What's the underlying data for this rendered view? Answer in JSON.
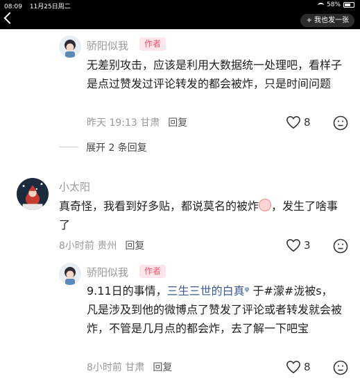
{
  "status_bar": {
    "time": "08:09",
    "date": "11月25日周二",
    "battery": "58%"
  },
  "header": {
    "new_button": "+ 我也发一张"
  },
  "comments": [
    {
      "author": "骄阳似我",
      "badge": "作者",
      "text": "无差别攻击，应该是利用大数据统一处理吧，看样子是点过赞发过评论转发的都会被炸，只是时间问题",
      "time_location": "昨天 19:13 甘肃",
      "reply_label": "回复",
      "likes": "8"
    },
    {
      "expand_label": "展开 2 条回复"
    },
    {
      "author": "小太阳",
      "text_before": "真奇怪，我看到好多贴，都说莫名的被炸",
      "text_after": "，发生了啥事了",
      "time_location": "8小时前 贵州",
      "reply_label": "回复",
      "likes": "3"
    },
    {
      "author": "骄阳似我",
      "badge": "作者",
      "text_prefix": "9.11日的事情，",
      "link_text": "三生三世的白真",
      "text_suffix": "于#濛#泷被s，凡是涉及到他的微博点了赞发了评论或者转发就会被炸，不管是几月点的都会炸，去了解一下吧宝",
      "time_location": "8小时前 甘肃",
      "reply_label": "回复",
      "likes": "8"
    }
  ]
}
